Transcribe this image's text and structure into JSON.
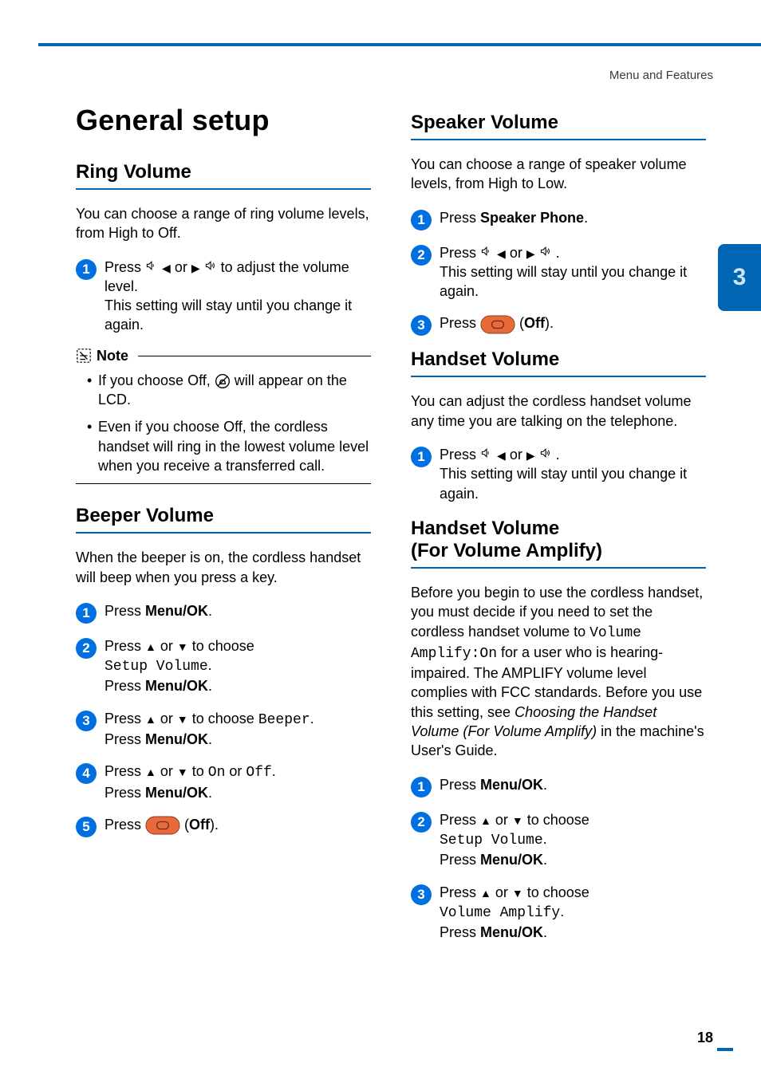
{
  "breadcrumb": "Menu and Features",
  "chapter_number": "3",
  "page_number": "18",
  "h1": "General setup",
  "left": {
    "ring": {
      "title": "Ring Volume",
      "intro": "You can choose a range of ring volume levels, from High to Off.",
      "step1_a": "Press ",
      "step1_b": " or ",
      "step1_c": " to adjust the volume level.",
      "step1_d": "This setting will stay until you change it again."
    },
    "note_label": "Note",
    "note_items": {
      "a1": "If you choose Off, ",
      "a2": " will appear on the LCD.",
      "b": "Even if you choose Off, the cordless handset will ring in the lowest volume level when you receive a transferred call."
    },
    "beeper": {
      "title": "Beeper Volume",
      "intro": "When the beeper is on, the cordless handset will beep when you press a key.",
      "s1_a": "Press ",
      "s1_b": "Menu/OK",
      "s1_c": ".",
      "s2_a": "Press ",
      "s2_b": " or ",
      "s2_c": " to choose ",
      "s2_d": "Setup Volume",
      "s2_e": ".",
      "s2_f": "Press ",
      "s2_g": "Menu/OK",
      "s2_h": ".",
      "s3_a": "Press ",
      "s3_b": " or ",
      "s3_c": " to choose ",
      "s3_d": "Beeper",
      "s3_e": ".",
      "s3_f": "Press ",
      "s3_g": "Menu/OK",
      "s3_h": ".",
      "s4_a": "Press ",
      "s4_b": " or ",
      "s4_c": " to ",
      "s4_d": "On",
      "s4_e": " or ",
      "s4_f": "Off",
      "s4_g": ".",
      "s4_h": "Press ",
      "s4_i": "Menu/OK",
      "s4_j": ".",
      "s5_a": "Press ",
      "s5_b": " (",
      "s5_c": "Off",
      "s5_d": ")."
    }
  },
  "right": {
    "speaker": {
      "title": "Speaker Volume",
      "intro": "You can choose a range of speaker volume levels, from High to Low.",
      "s1_a": "Press ",
      "s1_b": "Speaker Phone",
      "s1_c": ".",
      "s2_a": "Press ",
      "s2_b": " or ",
      "s2_c": ".",
      "s2_d": "This setting will stay until you change it again.",
      "s3_a": "Press ",
      "s3_b": " (",
      "s3_c": "Off",
      "s3_d": ")."
    },
    "handset": {
      "title": "Handset Volume",
      "intro": "You can adjust the cordless handset volume any time you are talking on the telephone.",
      "s1_a": "Press ",
      "s1_b": " or ",
      "s1_c": ".",
      "s1_d": "This setting will stay until you change it again."
    },
    "amplify": {
      "title_l1": "Handset Volume",
      "title_l2": "(For Volume Amplify)",
      "intro_a": "Before you begin to use the cordless handset, you must decide if you need to set the cordless handset volume to ",
      "intro_b": "Volume Amplify:On",
      "intro_c": " for a user who is hearing-impaired. The AMPLIFY volume level complies with FCC standards. Before you use this setting, see ",
      "intro_d": "Choosing the Handset Volume (For Volume Amplify)",
      "intro_e": " in the machine's User's Guide.",
      "s1_a": "Press ",
      "s1_b": "Menu/OK",
      "s1_c": ".",
      "s2_a": "Press ",
      "s2_b": " or ",
      "s2_c": " to choose ",
      "s2_d": "Setup Volume",
      "s2_e": ".",
      "s2_f": "Press ",
      "s2_g": "Menu/OK",
      "s2_h": ".",
      "s3_a": "Press ",
      "s3_b": " or ",
      "s3_c": " to choose ",
      "s3_d": "Volume Amplify",
      "s3_e": ".",
      "s3_f": "Press ",
      "s3_g": "Menu/OK",
      "s3_h": "."
    }
  }
}
